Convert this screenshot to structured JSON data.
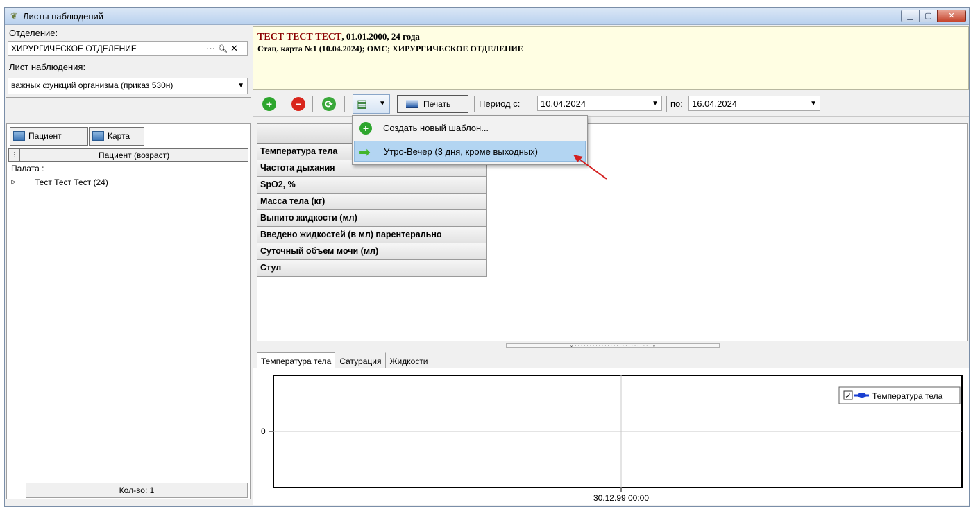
{
  "window": {
    "title": "Листы наблюдений",
    "controls": {
      "minimize": "▁",
      "maximize": "▢",
      "close": "✕"
    }
  },
  "left": {
    "department_label": "Отделение:",
    "department_value": "ХИРУРГИЧЕСКОЕ ОТДЕЛЕНИЕ",
    "department_icons": {
      "ellipsis": "···",
      "search": "🔍︎",
      "clear": "✕"
    },
    "sheet_label": "Лист наблюдения:",
    "sheet_value": "важных функций организма (приказ 530н)",
    "buttons": {
      "patient": "Пациент",
      "card": "Карта"
    },
    "grid": {
      "header": "Пациент (возраст)",
      "group_row": "Палата :",
      "patient_row": "Тест Тест Тест (24)"
    },
    "count": "Кол-во: 1"
  },
  "patient": {
    "name": "ТЕСТ ТЕСТ ТЕСТ",
    "details": ", 01.01.2000, 24 года",
    "card": "Стац. карта №1 (10.04.2024); ОМС; ХИРУРГИЧЕСКОЕ ОТДЕЛЕНИЕ"
  },
  "toolbar": {
    "print_label": "Печать",
    "period_from_label": "Период с:",
    "period_from": "10.04.2024",
    "period_to_label": "по:",
    "period_to": "16.04.2024"
  },
  "observations": [
    "Температура тела",
    "Частота дыхания",
    "SpO2, %",
    "Масса тела (кг)",
    "Выпито жидкости (мл)",
    "Введено жидкостей (в мл) парентерально",
    "Суточный объем мочи (мл)",
    "Стул"
  ],
  "dropdown": {
    "create_template": "Создать новый шаблон...",
    "template_1": "Утро-Вечер (3 дня, кроме выходных)"
  },
  "chart_tabs": [
    "Температура тела",
    "Сатурация",
    "Жидкости"
  ],
  "colors": {
    "accent_red": "#8b0000",
    "series_blue": "#1a3fd1",
    "highlight": "#b3d5f2",
    "header_bg": "#fffee3"
  },
  "chart_data": {
    "type": "line",
    "title": "",
    "x": [
      "30.12.99 00:00"
    ],
    "y_ticks": [
      "0"
    ],
    "series": [
      {
        "name": "Температура тела",
        "color": "#1a3fd1",
        "values": []
      }
    ],
    "legend": "top-right",
    "legend_checked": true,
    "grid": true
  }
}
